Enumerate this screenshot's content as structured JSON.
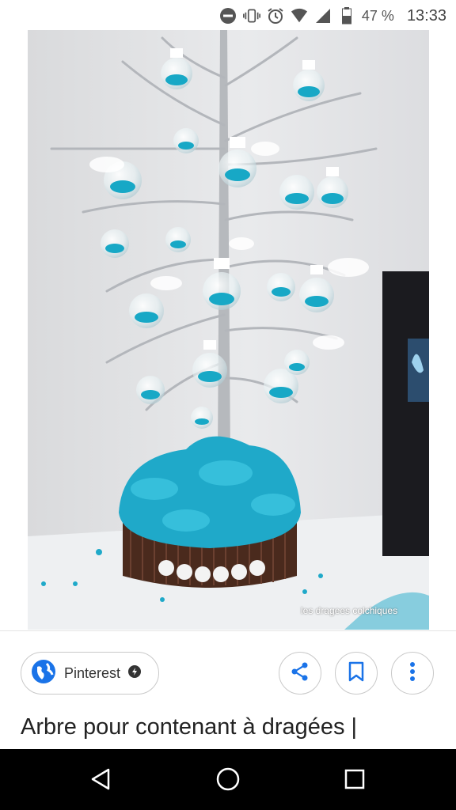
{
  "status_bar": {
    "battery": "47 %",
    "time": "13:33",
    "icons": [
      "do-not-disturb-icon",
      "vibrate-icon",
      "alarm-icon",
      "wifi-icon",
      "signal-icon",
      "battery-icon"
    ]
  },
  "image": {
    "watermark": "les dragees colchiques"
  },
  "source": {
    "label": "Pinterest"
  },
  "actions": [
    "share-icon",
    "bookmark-icon",
    "more-icon"
  ],
  "caption": "Arbre pour contenant à dragées |",
  "nav": [
    "back-icon",
    "home-icon",
    "recents-icon"
  ],
  "colors": {
    "accent": "#1a73e8",
    "teal": "#1fa9c9",
    "nav_bg": "#000000"
  }
}
